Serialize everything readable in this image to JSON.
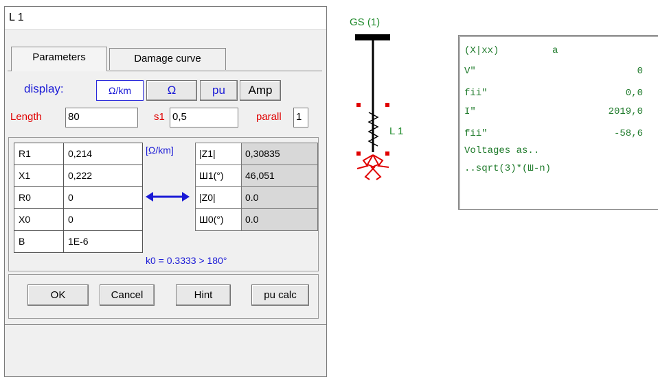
{
  "dialog": {
    "title": "L 1",
    "tabs": [
      "Parameters",
      "Damage curve"
    ],
    "display": {
      "label": "display:",
      "options": [
        "Ω/km",
        "Ω",
        "pu",
        "Amp"
      ]
    },
    "length": {
      "label": "Length",
      "value": "80"
    },
    "s1": {
      "label": "s1",
      "value": "0,5"
    },
    "parall": {
      "label": "parall",
      "value": "1"
    },
    "params": [
      {
        "name": "R1",
        "value": "0,214"
      },
      {
        "name": "X1",
        "value": "0,222"
      },
      {
        "name": "R0",
        "value": "0"
      },
      {
        "name": "X0",
        "value": "0"
      },
      {
        "name": "B",
        "value": "1E-6"
      }
    ],
    "unit_label": "[Ω/km]",
    "derived": [
      {
        "name": "|Z1|",
        "value": "0,30835"
      },
      {
        "name": "Ш1(°)",
        "value": "46,051"
      },
      {
        "name": "|Z0|",
        "value": "0.0"
      },
      {
        "name": "Ш0(°)",
        "value": "0.0"
      }
    ],
    "k0_text": "k0 = 0.3333 > 180°",
    "buttons": {
      "ok": "OK",
      "cancel": "Cancel",
      "hint": "Hint",
      "pu_calc": "pu calc"
    }
  },
  "diagram": {
    "gs_label": "GS (1)",
    "line_label": "L 1"
  },
  "results": {
    "header_left": "(X|xx)",
    "header_right": "a",
    "rows": [
      {
        "label": "V\"",
        "value": "0"
      },
      {
        "label": "fii\"",
        "value": "0,0"
      },
      {
        "label": "I\"",
        "value": "2019,0"
      },
      {
        "label": "fii\"",
        "value": "-58,6"
      }
    ],
    "note1": "Voltages as..",
    "note2": "..sqrt(3)*(Ш-n)"
  },
  "colors": {
    "accent_blue": "#1a1ad6",
    "label_red": "#e00000",
    "diagram_green": "#1e8a2a",
    "fault_red": "#e00000"
  }
}
